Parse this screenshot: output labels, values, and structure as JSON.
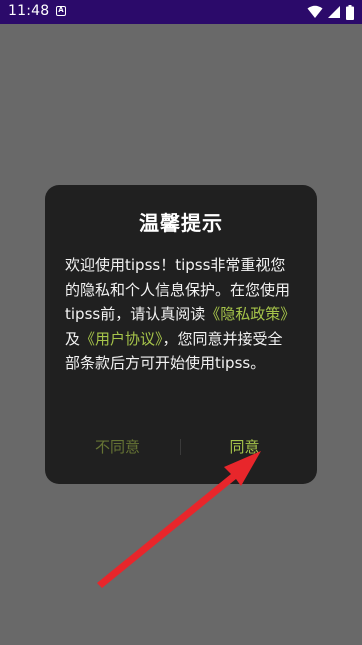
{
  "status_bar": {
    "time": "11:48",
    "notification_glyph": "A",
    "icons": [
      "wifi-icon",
      "signal-icon",
      "battery-icon"
    ]
  },
  "dialog": {
    "title": "温馨提示",
    "body_intro": "欢迎使用tipss！tipss非常重视您的隐私和个人信息保护。在您使用tipss前，请认真阅读",
    "privacy_link": "《隐私政策》",
    "connector": "及",
    "user_agreement_link": "《用户协议》",
    "body_outro": "，您同意并接受全部条款后方可开始使用tipss。",
    "disagree_label": "不同意",
    "agree_label": "同意"
  },
  "colors": {
    "status_bar": "#2b0a6a",
    "backdrop": "#696969",
    "dialog_bg": "#202020",
    "link": "#a6c44a",
    "disagree": "#667434",
    "arrow": "#e8262b"
  },
  "annotation": {
    "arrow_icon": "red-arrow-icon"
  }
}
